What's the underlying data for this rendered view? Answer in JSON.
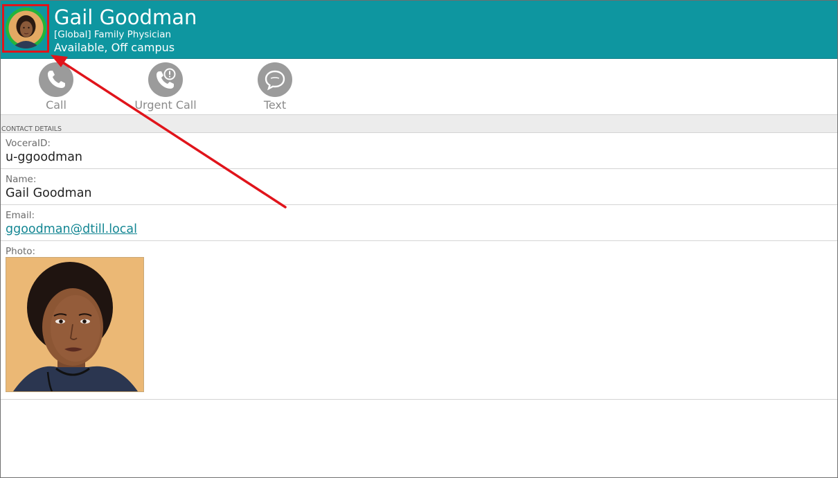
{
  "header": {
    "name": "Gail Goodman",
    "role": "[Global] Family Physician",
    "status": "Available, Off campus",
    "avatar_icon": "user-photo",
    "background_color": "#0e96a0",
    "avatar_ring_color": "#22b43c"
  },
  "actions": [
    {
      "label": "Call",
      "icon": "phone-icon"
    },
    {
      "label": "Urgent Call",
      "icon": "urgent-phone-icon"
    },
    {
      "label": "Text",
      "icon": "chat-bubble-icon"
    }
  ],
  "contact_details": {
    "section_title": "CONTACT DETAILS",
    "fields": [
      {
        "label": "VoceraID:",
        "value": "u-ggoodman"
      },
      {
        "label": "Name:",
        "value": "Gail Goodman"
      },
      {
        "label": "Email:",
        "value": "ggoodman@dtill.local"
      },
      {
        "label": "Photo:"
      }
    ]
  },
  "annotation": {
    "highlight_color": "#e0141b",
    "type": "arrow pointing to avatar"
  }
}
